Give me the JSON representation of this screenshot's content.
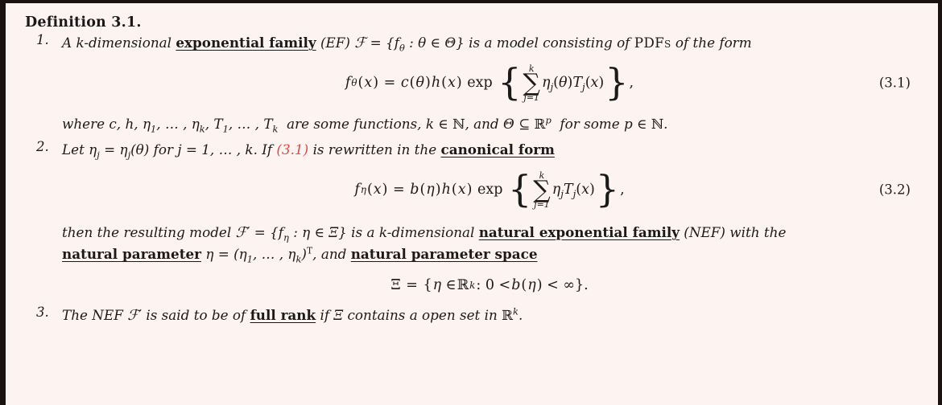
{
  "document": {
    "title": "Definition 3.1.",
    "background_color": "#fdf4f1",
    "border_color": "#1a1210",
    "text_color": "#1a1a1a",
    "reference_link_color": "#d94a4a"
  },
  "items": [
    {
      "number": "1.",
      "line1": {
        "before_term": "A k-dimensional",
        "term": "exponential family",
        "after_term_a": "(EF)",
        "math_a": "ℱ = {fθ : θ ∈ Θ}",
        "after_term_b": "is a model consisting of",
        "smallcaps": "PDFs",
        "after_term_c": "of the form"
      },
      "equation": {
        "id": "3.1",
        "number_label": "(3.1)",
        "lhs": "fθ(x)",
        "rhs": "c(θ)h(x) exp { ∑_{j=1}^{k} ηⱼ(θ)Tⱼ(x) },",
        "sum_upper": "k",
        "sum_lower": "j=1",
        "summand": "ηⱼ(θ)Tⱼ(x)"
      },
      "line2": "where c, h, η₁, …, ηₖ, T₁, …, Tₖ are some functions, k ∈ ℕ, and Θ ⊆ ℝᵖ for some p ∈ ℕ."
    },
    {
      "number": "2.",
      "line1": {
        "before": "Let ηⱼ = ηⱼ(θ) for j = 1, …, k. If",
        "ref": "(3.1)",
        "middle": "is rewritten in the",
        "term": "canonical form"
      },
      "equation": {
        "id": "3.2",
        "number_label": "(3.2)",
        "lhs": "fη(x)",
        "rhs": "b(η)h(x) exp { ∑_{j=1}^{k} ηⱼTⱼ(x) },",
        "sum_upper": "k",
        "sum_lower": "j=1",
        "summand": "ηⱼTⱼ(x)"
      },
      "line2": {
        "before_term": "then the resulting model ℱ′ = {fη : η ∈ Ξ} is a k-dimensional",
        "term": "natural exponential family",
        "after_term": "(NEF) with the"
      },
      "line3": {
        "term1": "natural parameter",
        "middle": "η = (η₁, …, ηₖ)ᵀ, and",
        "term2": "natural parameter space"
      },
      "equation2": {
        "body": "Ξ = {η ∈ ℝᵏ : 0 < b(η) < ∞}."
      }
    },
    {
      "number": "3.",
      "line1": {
        "before_term": "The NEF ℱ′ is said to be of",
        "term": "full rank",
        "after_term": "if Ξ contains a open set in ℝᵏ."
      }
    }
  ]
}
